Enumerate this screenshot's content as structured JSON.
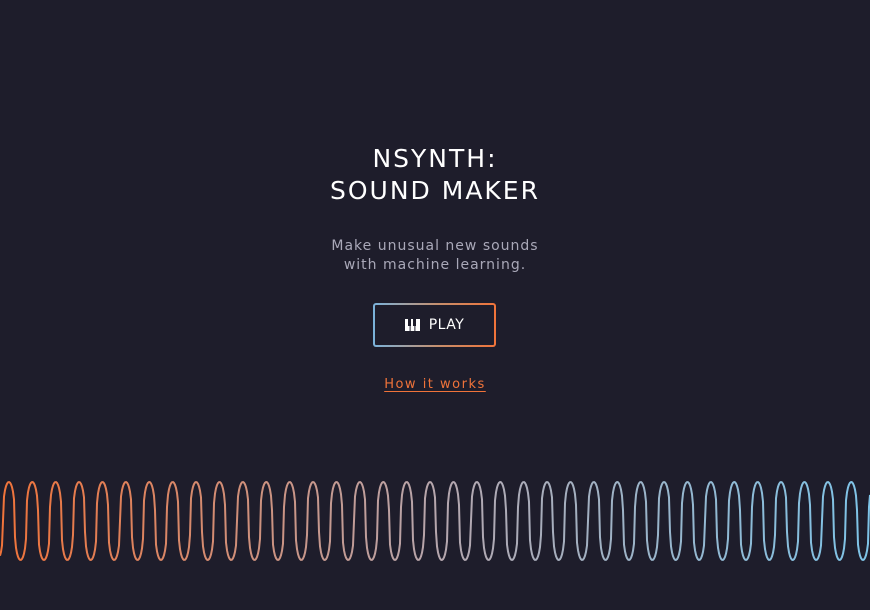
{
  "hero": {
    "title_line1": "NSYNTH:",
    "title_line2": "SOUND MAKER",
    "subtitle_line1": "Make unusual new sounds",
    "subtitle_line2": "with machine learning."
  },
  "actions": {
    "play_label": "PLAY",
    "play_icon": "piano-keys-icon",
    "how_it_works_label": "How it works"
  },
  "decoration": {
    "waveform_icon": "sine-waveform",
    "gradient_start_color": "#f0733a",
    "gradient_end_color": "#7ec4e8"
  },
  "colors": {
    "background": "#1e1d2b",
    "accent_orange": "#f0733a",
    "accent_blue": "#7ab2db",
    "text_primary": "#ffffff",
    "text_secondary": "#a9a8b8"
  }
}
